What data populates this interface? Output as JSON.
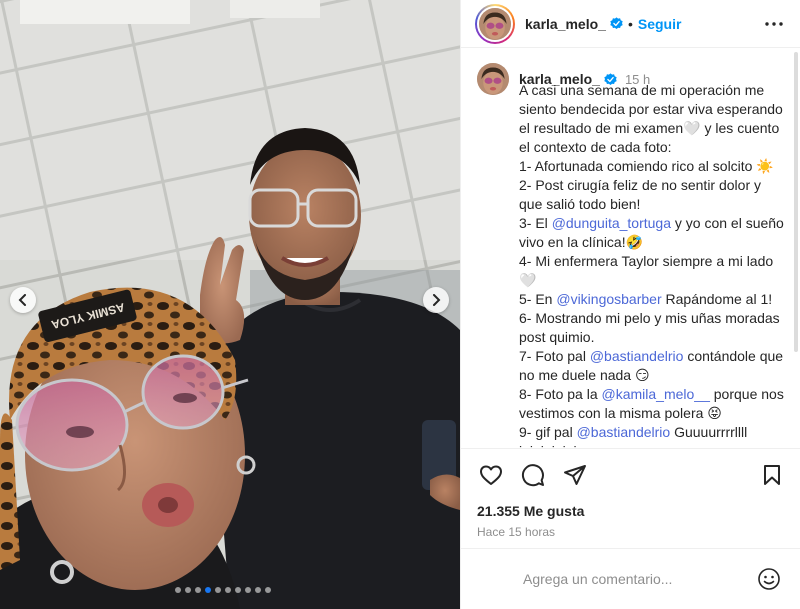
{
  "post": {
    "author": "karla_melo_",
    "verified_icon": "verified-badge-icon",
    "separator": "•",
    "follow_label": "Seguir",
    "time_short": "15 h",
    "caption_lines": [
      {
        "text": "A casi una semana de mi operación me siento bendecida por estar viva esperando el resultado de mi examen🤍 y les cuento el contexto de cada foto:"
      },
      {
        "text": "1- Afortunada comiendo rico al solcito ☀️"
      },
      {
        "text": "2- Post cirugía feliz de no sentir dolor y que salió todo bien!"
      },
      {
        "pre": "3- El ",
        "mention": "@dunguita_tortuga",
        "post": " y yo con el sueño vivo en la clínica!🤣"
      },
      {
        "text": "4- Mi enfermera Taylor siempre a mi lado 🤍"
      },
      {
        "pre": "5- En ",
        "mention": "@vikingosbarber",
        "post": " Rapándome al 1!"
      },
      {
        "text": "6- Mostrando mi pelo y mis uñas moradas post quimio."
      },
      {
        "pre": "7- Foto pal ",
        "mention": "@bastiandelrio",
        "post": " contándole que no me duele nada 😏"
      },
      {
        "pre": "8- Foto pa la ",
        "mention": "@kamila_melo__",
        "post": " porque nos vestimos con la misma polera 😝"
      },
      {
        "pre": "9- gif pal ",
        "mention": "@bastiandelrio",
        "post": "  Guuuurrrrllll jajajajajaja"
      }
    ],
    "likes": "21.355 Me gusta",
    "time_long": "Hace 15 horas",
    "comment_placeholder": "Agrega un comentario..."
  },
  "carousel": {
    "slide_count": 10,
    "active_index": 3
  },
  "colors": {
    "link": "#0095f6",
    "mention": "#4c68d7",
    "muted": "#8e8e8e",
    "verified": "#0095f6"
  }
}
